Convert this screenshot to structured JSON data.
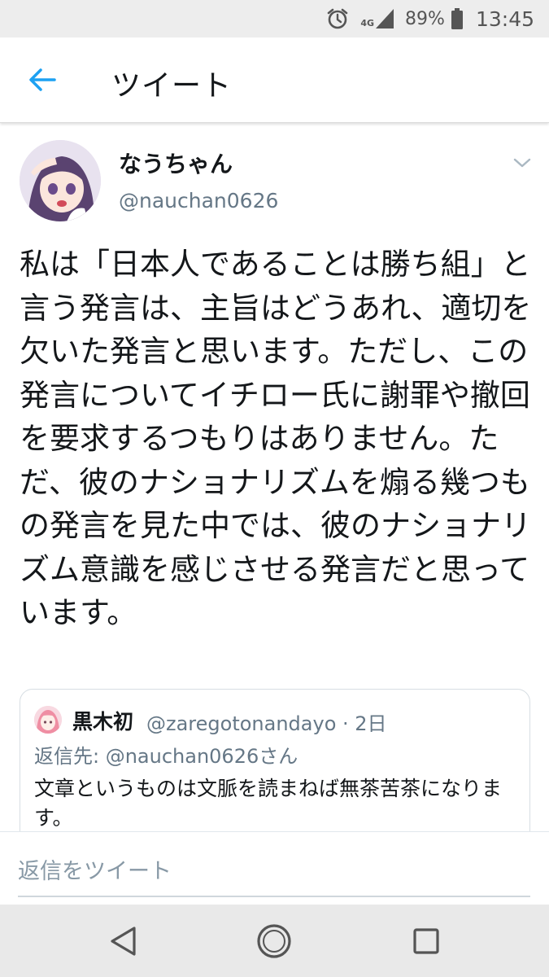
{
  "status_bar": {
    "alarm_icon": "alarm-clock-icon",
    "network_label": "4G",
    "battery_percent": "89%",
    "time": "13:45"
  },
  "app_bar": {
    "back_icon": "arrow-left-icon",
    "title": "ツイート",
    "accent_color": "#1da1f2"
  },
  "tweet": {
    "display_name": "なうちゃん",
    "handle": "@nauchan0626",
    "text": "私は「日本人であることは勝ち組」と言う発言は、主旨はどうあれ、適切を欠いた発言と思います。ただし、この発言についてイチロー氏に謝罪や撤回を要求するつもりはありません。ただ、彼のナショナリズムを煽る幾つもの発言を見た中では、彼のナショナリズム意識を感じさせる発言だと思っています。"
  },
  "quoted_tweet": {
    "display_name": "黒木初",
    "handle_and_time": "@zaregotonandayo · 2日",
    "reply_to": "返信先: @nauchan0626さん",
    "text": "文章というものは文脈を読まねば無茶苦茶になります。"
  },
  "reply_bar": {
    "placeholder": "返信をツイート"
  },
  "nav_bar": {
    "back_icon": "triangle-back-icon",
    "home_icon": "circle-home-icon",
    "recents_icon": "square-recents-icon"
  }
}
